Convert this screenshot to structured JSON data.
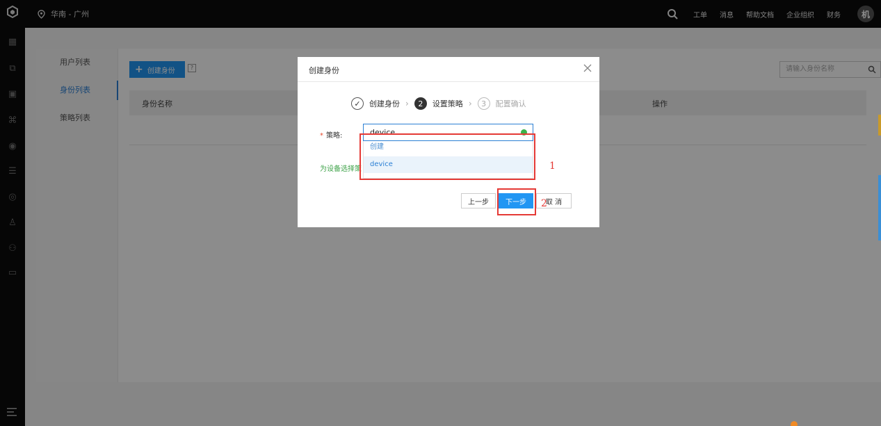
{
  "topbar": {
    "region": "华南 - 广州",
    "nav": [
      "工单",
      "消息",
      "帮助文档",
      "企业组织",
      "财务"
    ],
    "avatar": "机"
  },
  "sidebar": {
    "icons": [
      "dashboard-icon",
      "network-icon",
      "qrcode-icon",
      "plugin-icon",
      "eye-icon",
      "database-icon",
      "globe-icon",
      "user-icon",
      "users-icon",
      "inbox-icon"
    ]
  },
  "subnav": {
    "items": [
      {
        "label": "用户列表",
        "active": false
      },
      {
        "label": "身份列表",
        "active": true
      },
      {
        "label": "策略列表",
        "active": false
      }
    ]
  },
  "page": {
    "create_label": "创建身份",
    "help_label": "?",
    "search_placeholder": "请输入身份名称",
    "columns": [
      "身份名称",
      "操作"
    ]
  },
  "modal": {
    "title": "创建身份",
    "steps": [
      {
        "num": "✓",
        "label": "创建身份",
        "state": "done"
      },
      {
        "num": "2",
        "label": "设置策略",
        "state": "current"
      },
      {
        "num": "3",
        "label": "配置确认",
        "state": "todo"
      }
    ],
    "policy_label": "策略:",
    "policy_value": "device",
    "dropdown": [
      "创建",
      "device"
    ],
    "hint": "为设备选择策",
    "prev_label": "上一步",
    "next_label": "下一步",
    "cancel_label": "取 消"
  },
  "annotations": {
    "one": "1",
    "two": "2",
    "color": "#e53935"
  },
  "colors": {
    "accent": "#2196f3",
    "success": "#3cb34a"
  }
}
